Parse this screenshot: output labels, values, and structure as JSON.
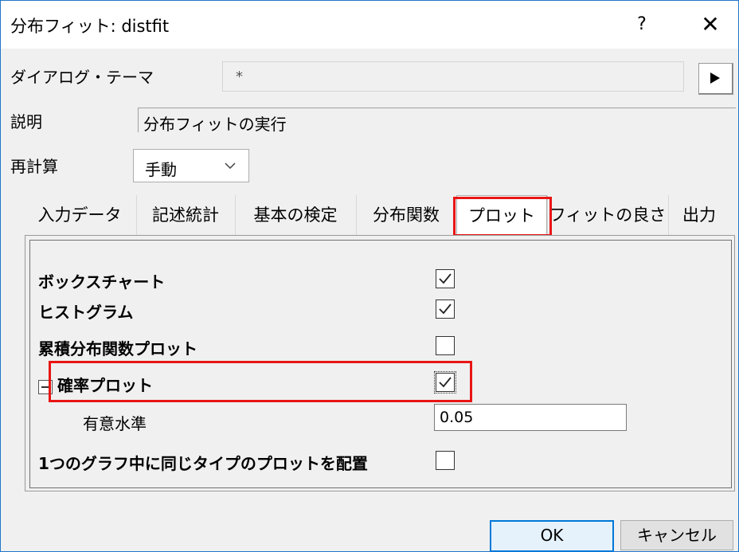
{
  "window": {
    "title": "分布フィット: distfit",
    "help_label": "?",
    "close_label": "✕"
  },
  "theme": {
    "label": "ダイアログ・テーマ",
    "value": "*"
  },
  "description": {
    "label": "説明",
    "value": "分布フィットの実行"
  },
  "recalc": {
    "label": "再計算",
    "value": "手動"
  },
  "tabs": [
    {
      "label": "入力データ",
      "active": false
    },
    {
      "label": "記述統計",
      "active": false
    },
    {
      "label": "基本の検定",
      "active": false
    },
    {
      "label": "分布関数",
      "active": false
    },
    {
      "label": "プロット",
      "active": true
    },
    {
      "label": "フィットの良さ",
      "active": false
    },
    {
      "label": "出力",
      "active": false
    }
  ],
  "options": {
    "box_chart": {
      "label": "ボックスチャート",
      "checked": true
    },
    "histogram": {
      "label": "ヒストグラム",
      "checked": true
    },
    "cdf_plot": {
      "label": "累積分布関数プロット",
      "checked": false
    },
    "prob_plot": {
      "label": "確率プロット",
      "checked": true
    },
    "sig_level": {
      "label": "有意水準",
      "value": "0.05"
    },
    "same_graph": {
      "label": "1つのグラフ中に同じタイプのプロットを配置",
      "checked": false
    }
  },
  "buttons": {
    "ok": "OK",
    "cancel": "キャンセル"
  },
  "colors": {
    "highlight": "#e81515",
    "accent": "#0078d7"
  }
}
